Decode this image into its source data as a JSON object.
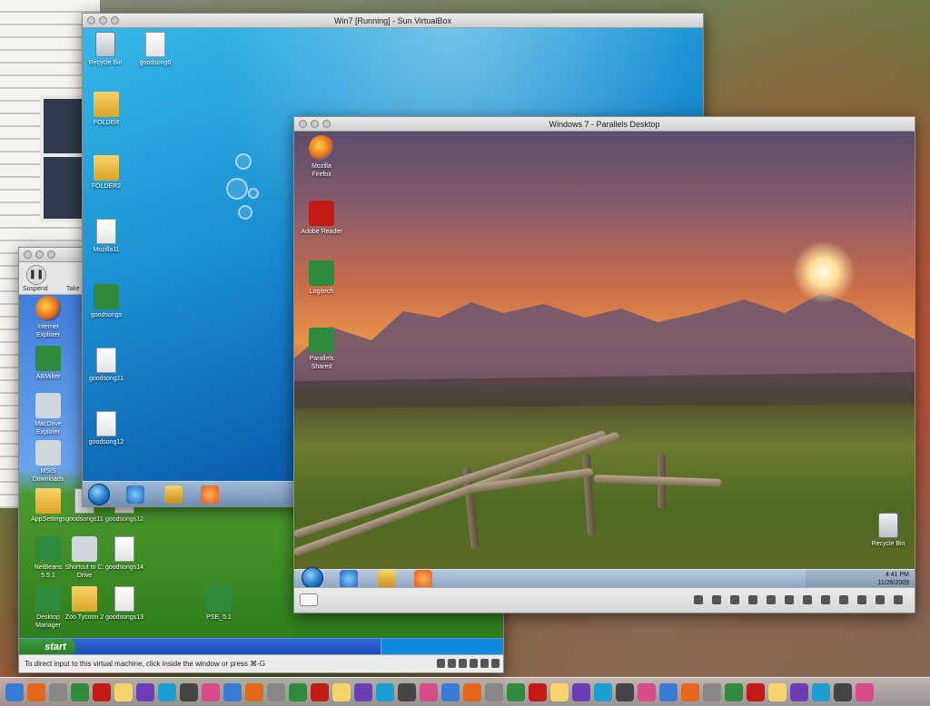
{
  "mac_desktop": {
    "dock_item_count": 40
  },
  "xp_window": {
    "toolbar": {
      "suspend_label": "Suspend",
      "take_label": "Take"
    },
    "icons": [
      {
        "label": "Internet\nExplorer",
        "icon": "ie-icon"
      },
      {
        "label": "ABMilter",
        "icon": "app-icon"
      },
      {
        "label": "MacDrive\nExplorer",
        "icon": "drive-icon"
      },
      {
        "label": "MSIS\nDownloads",
        "icon": "drive-icon"
      },
      {
        "label": "AppSettings",
        "icon": "folder-icon"
      },
      {
        "label": "goodsongs11",
        "icon": "file-icon"
      },
      {
        "label": "goodsongs12",
        "icon": "file-icon"
      },
      {
        "label": "NetBeans\n5.5.1",
        "icon": "app-icon"
      },
      {
        "label": "Shortcut to C:\nDrive",
        "icon": "drive-icon"
      },
      {
        "label": "goodsongs14",
        "icon": "file-icon"
      },
      {
        "label": "Desktop\nManager",
        "icon": "app-icon"
      },
      {
        "label": "Zoo Tycoon 2",
        "icon": "game-icon"
      },
      {
        "label": "goodsongs13",
        "icon": "file-icon"
      },
      {
        "label": "PSE_5.1",
        "icon": "app-icon"
      }
    ],
    "taskbar": {
      "start_label": "start"
    },
    "status_text": "To direct input to this virtual machine, click inside the window or press ⌘-G"
  },
  "vbox_window": {
    "title": "Win7 [Running] - Sun VirtualBox",
    "icons": [
      {
        "label": "Recycle Bin",
        "icon": "recycle-bin-icon"
      },
      {
        "label": "goodsong6",
        "icon": "file-icon"
      },
      {
        "label": "FOLDER",
        "icon": "folder-icon"
      },
      {
        "label": "FOLDER2",
        "icon": "folder-icon"
      },
      {
        "label": "Mozilla11",
        "icon": "file-icon"
      },
      {
        "label": "goodsongs",
        "icon": "app-icon"
      },
      {
        "label": "goodsong11",
        "icon": "file-icon"
      },
      {
        "label": "goodsong12",
        "icon": "file-icon"
      }
    ]
  },
  "parallels_window": {
    "title": "Windows 7 - Parallels Desktop",
    "icons": [
      {
        "label": "Mozilla\nFirefox",
        "icon": "firefox-icon"
      },
      {
        "label": "Adobe Reader",
        "icon": "pdf-icon"
      },
      {
        "label": "Logitech",
        "icon": "app-icon"
      },
      {
        "label": "Parallels\nShared",
        "icon": "app-icon"
      }
    ],
    "recycle_label": "Recycle Bin",
    "clock": {
      "time": "4:41 PM",
      "date": "11/26/2009"
    }
  }
}
